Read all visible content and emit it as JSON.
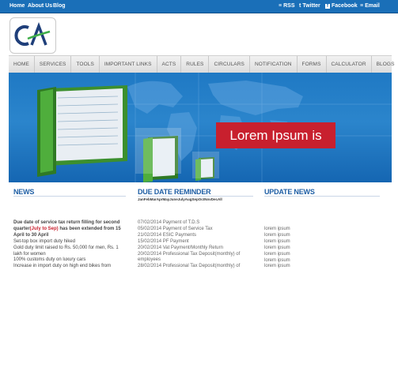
{
  "topbar": {
    "links": [
      "Home",
      "About Us",
      "Blog"
    ],
    "right": [
      {
        "label": "RSS",
        "icon": "rss-icon"
      },
      {
        "label": "Twitter",
        "icon": "twitter-icon"
      },
      {
        "label": "Facebook",
        "icon": "facebook-icon"
      },
      {
        "label": "Email",
        "icon": "email-icon"
      }
    ],
    "color": "#1a6fb8"
  },
  "logo": {
    "text": "CA"
  },
  "nav": {
    "items": [
      "HOME",
      "SERVICES",
      "TOOLS",
      "IMPORTANT LINKS",
      "ACTS",
      "RULES",
      "CIRCULARS",
      "NOTIFICATION",
      "FORMS",
      "CALCULATOR",
      "BLOGS"
    ]
  },
  "banner": {
    "caption": "Lorem Ipsum is",
    "caption_color": "#c8202e"
  },
  "news": {
    "title": "NEWS",
    "lead": "Due date of service tax return filling for second quarter",
    "lead_red": "(July to Sep)",
    "lead_tail": " has been extended from 15 April to 30 April",
    "items": [
      "Set-top box import duty hiked",
      "Gold duty limit raised to Rs. 50,000 for men, Rs. 1 lakh for women",
      "100% customs duty on luxury cars",
      "Increase in import duty on high end bikes from"
    ]
  },
  "due": {
    "title": "DUE DATE REMINDER",
    "months": "JanFebMarAprMayJuneJulyAugSepOctNovDecAll",
    "items": [
      "07/02/2014 Payment of T.D.S",
      "05/02/2014 Payment of Service Tax",
      "21/02/2014 ESIC Payments",
      "15/02/2014 PF Payment",
      "20/02/2014 Vat Payment/Monthly Return",
      "20/02/2014 Professional Tax Deposit(monthly) of employees",
      "28/02/2014 Professional Tax Deposit(monthly) of"
    ]
  },
  "updates": {
    "title": "UPDATE NEWS",
    "items": [
      "lorem ipsum",
      "lorem ipsum",
      "lorem ipsum",
      "lorem ipsum",
      "lorem ipsum",
      "lorem ipsum",
      "lorem ipsum"
    ]
  }
}
